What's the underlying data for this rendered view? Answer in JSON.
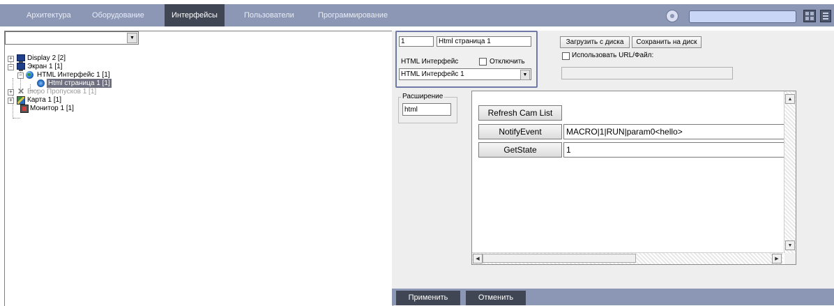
{
  "tabs": [
    {
      "label": "Архитектура"
    },
    {
      "label": "Оборудование"
    },
    {
      "label": "Интерфейсы"
    },
    {
      "label": "Пользователи"
    },
    {
      "label": "Программирование"
    }
  ],
  "active_tab": "Интерфейсы",
  "left": {
    "filter_value": "",
    "tree": [
      {
        "label": "Display 2 [2]"
      },
      {
        "label": "Экран 1 [1]"
      },
      {
        "label": "HTML Интерфейс 1 [1]"
      },
      {
        "label": "Html страница 1 [1]"
      },
      {
        "label": "Бюро Пропусков 1 [1]"
      },
      {
        "label": "Карта 1 [1]"
      },
      {
        "label": "Монитор 1 [1]"
      }
    ]
  },
  "settings": {
    "id_value": "1",
    "name_value": "Html страница 1",
    "html_interface_label": "HTML Интерфейс",
    "disable_label": "Отключить",
    "interface_select": "HTML Интерфейс 1",
    "load_button": "Загрузить с диска",
    "save_button": "Сохранить на диск",
    "use_url_label": "Использовать URL/Файл:",
    "url_value": "",
    "extension_group": "Расширение",
    "extension_value": "html"
  },
  "html_page": {
    "refresh_button": "Refresh Cam List",
    "notify_button": "NotifyEvent",
    "notify_value": "MACRO|1|RUN|param0<hello>",
    "getstate_button": "GetState",
    "getstate_value": "1"
  },
  "footer": {
    "apply": "Применить",
    "cancel": "Отменить"
  }
}
